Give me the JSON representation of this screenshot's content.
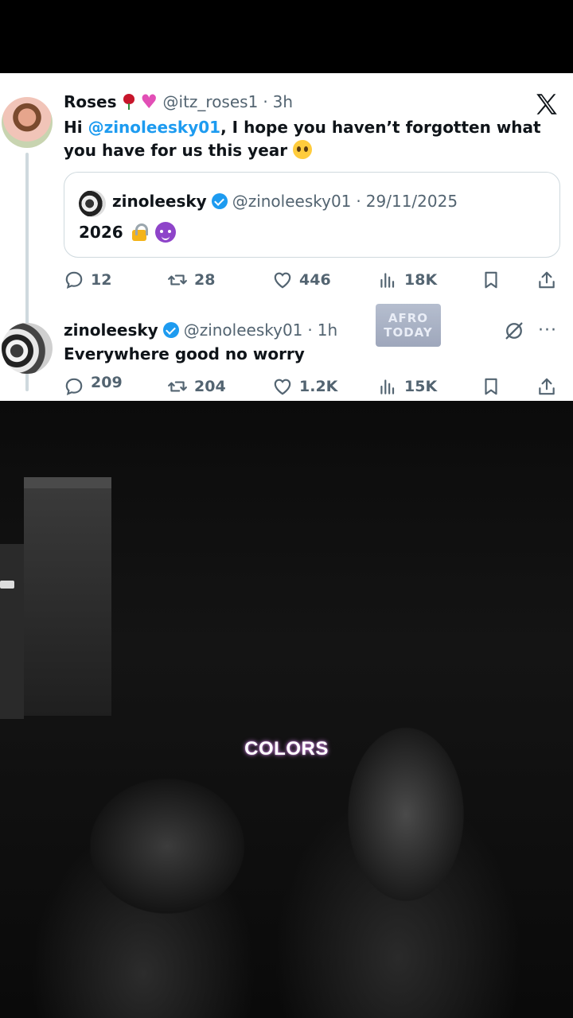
{
  "tweet1": {
    "name": "Roses",
    "handle": "@itz_roses1",
    "time": "3h",
    "text_prefix": "Hi ",
    "mention": "@zinoleesky01",
    "text_suffix": ", I hope you haven’t forgotten what you have for us this year",
    "quote": {
      "name": "zinoleesky",
      "handle": "@zinoleesky01",
      "date": "29/11/2025",
      "text": "2026"
    },
    "stats": {
      "replies": "12",
      "reposts": "28",
      "likes": "446",
      "views": "18K"
    }
  },
  "tweet2": {
    "name": "zinoleesky",
    "handle": "@zinoleesky01",
    "time": "1h",
    "text": "Everywhere good no worry",
    "stats": {
      "replies": "209",
      "reposts": "204",
      "likes": "1.2K",
      "views": "15K"
    }
  },
  "watermark": {
    "line1": "AFRO",
    "line2": "TODAY"
  },
  "video": {
    "caption": "COLORS"
  },
  "icons": {
    "platform": "x-logo-icon",
    "reply": "reply-icon",
    "repost": "repost-icon",
    "like": "heart-icon",
    "views": "views-icon",
    "bookmark": "bookmark-icon",
    "share": "share-icon",
    "grok": "grok-icon",
    "more": "more-icon"
  },
  "colors": {
    "mention": "#1d9bf0",
    "verified": "#1d9bf0",
    "muted": "#536471",
    "caption_glow": "#c47bd6"
  }
}
